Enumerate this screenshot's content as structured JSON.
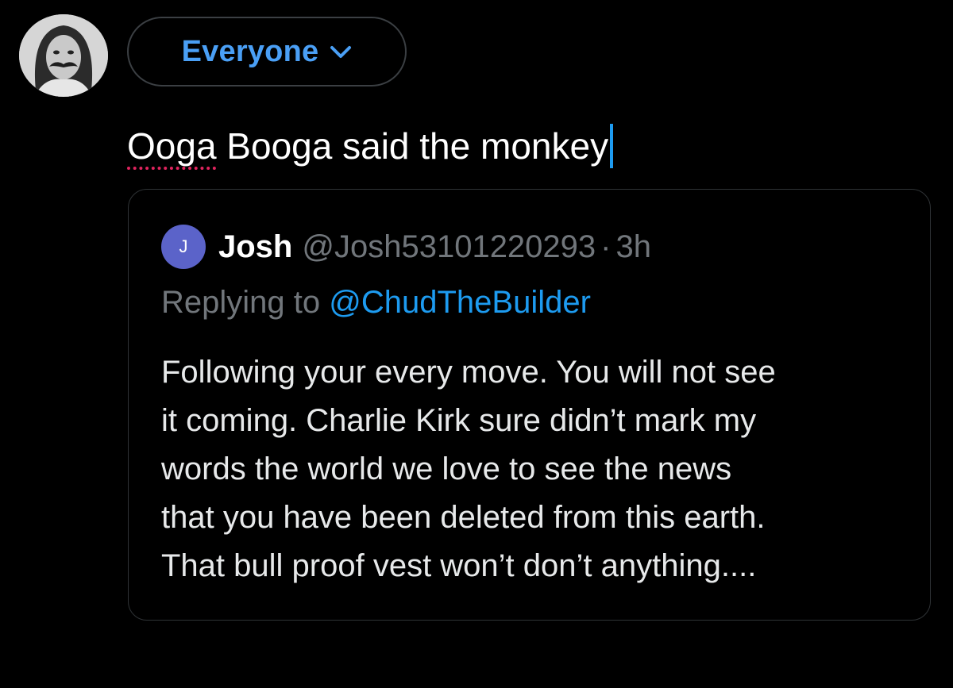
{
  "composer": {
    "avatar_icon": "user-avatar-icon",
    "audience_label": "Everyone",
    "audience_icon": "chevron-down-icon",
    "text_misspelled": "Ooga",
    "text_rest": " Booga said the monkey"
  },
  "quote": {
    "avatar_initial": "J",
    "name": "Josh",
    "handle": "@Josh53101220293",
    "separator": "·",
    "time": "3h",
    "replying_prefix": "Replying to ",
    "replying_handle": "@ChudTheBuilder",
    "body_lines": [
      "Following your every move. You will not see",
      "it coming. Charlie Kirk sure didn’t mark my",
      "words the world we love to see the news",
      "that you have been deleted from this earth.",
      "That bull proof vest won’t don’t anything...."
    ]
  },
  "colors": {
    "background": "#000000",
    "accent": "#1d9bf0",
    "secondary_text": "#71767b",
    "border": "#2f3336",
    "avatar_badge": "#5b63c9",
    "spellcheck_underline": "#e0245e"
  }
}
